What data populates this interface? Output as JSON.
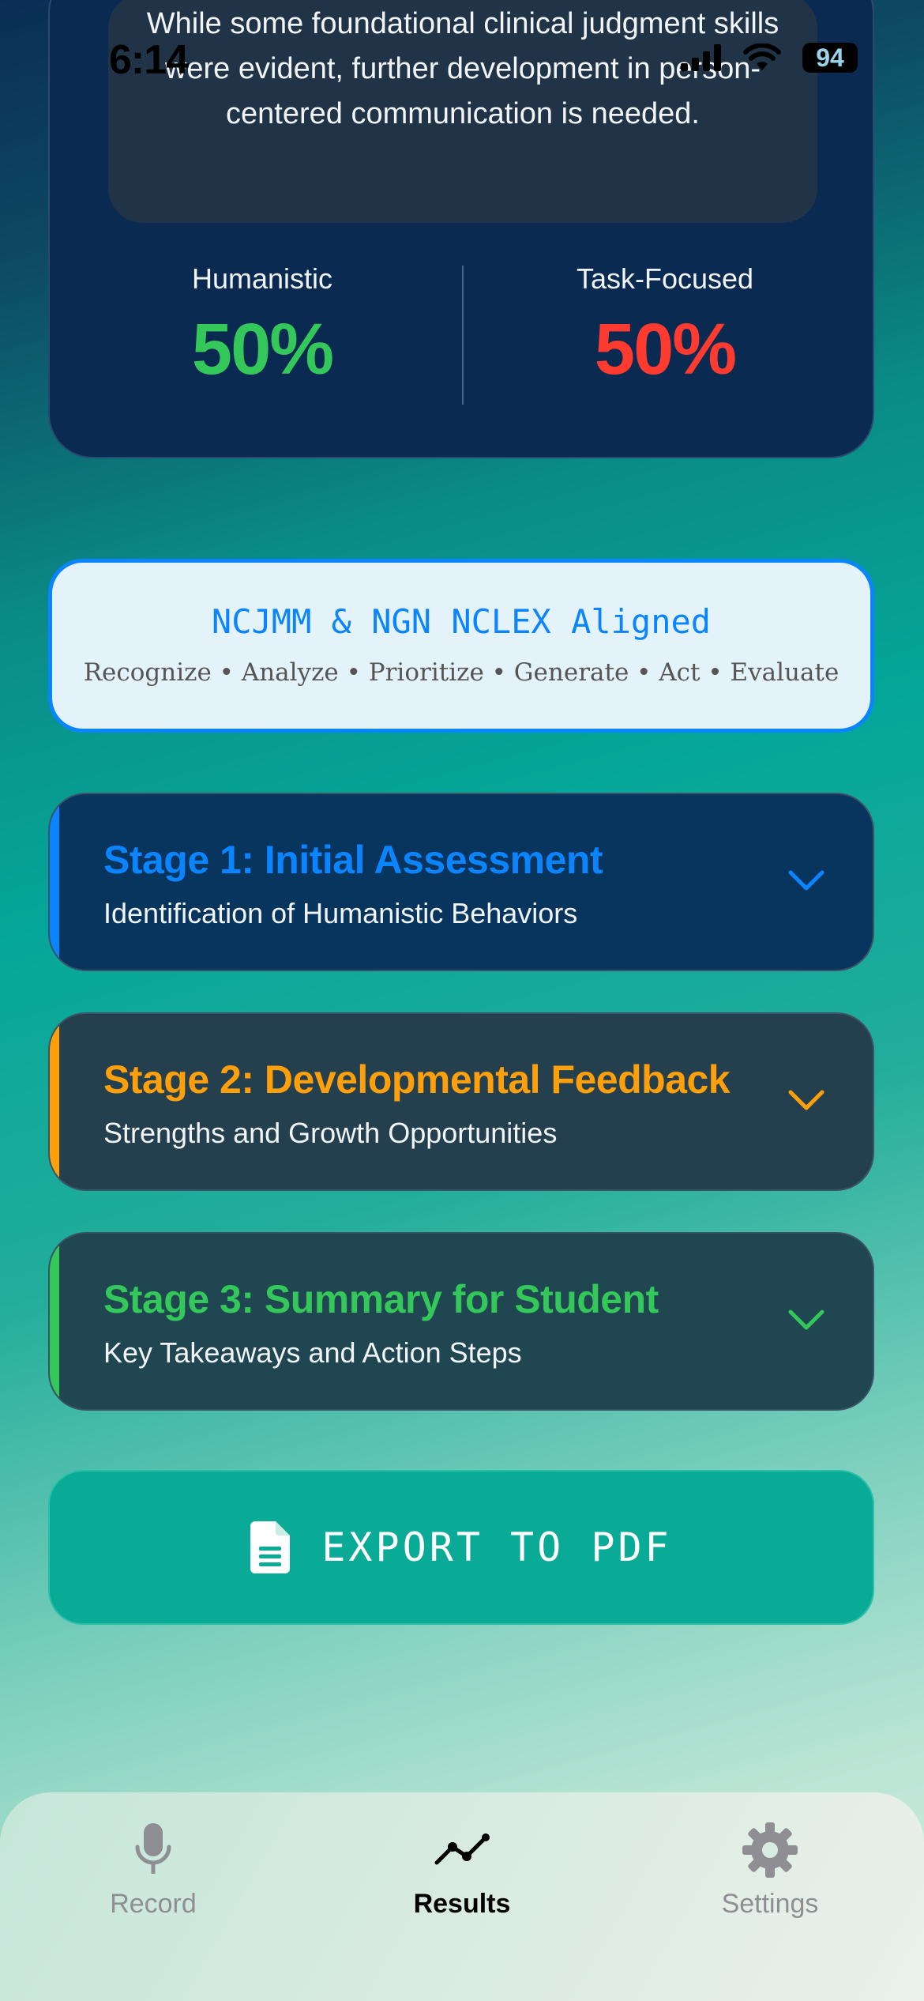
{
  "status_bar": {
    "time": "6:14",
    "battery": "94"
  },
  "summary": {
    "text": "While some foundational clinical judgment skills were evident, further development in person-centered communication is needed.",
    "humanistic_label": "Humanistic",
    "humanistic_value": "50%",
    "task_label": "Task-Focused",
    "task_value": "50%",
    "colors": {
      "humanistic": "#34c759",
      "task": "#ff3b30"
    }
  },
  "ncjmm": {
    "title": "NCJMM & NGN NCLEX Aligned",
    "subtitle": "Recognize • Analyze • Prioritize • Generate • Act • Evaluate"
  },
  "stages": [
    {
      "title": "Stage 1: Initial Assessment",
      "subtitle": "Identification of Humanistic Behaviors",
      "color": "#0a84ff"
    },
    {
      "title": "Stage 2: Developmental Feedback",
      "subtitle": "Strengths and Growth Opportunities",
      "color": "#ff9f0a"
    },
    {
      "title": "Stage 3: Summary for Student",
      "subtitle": "Key Takeaways and Action Steps",
      "color": "#34c759"
    }
  ],
  "export": {
    "label": "EXPORT TO PDF",
    "icon": "document-icon"
  },
  "tabs": [
    {
      "label": "Record",
      "icon": "microphone-icon",
      "active": false
    },
    {
      "label": "Results",
      "icon": "chart-line-icon",
      "active": true
    },
    {
      "label": "Settings",
      "icon": "gear-icon",
      "active": false
    }
  ]
}
